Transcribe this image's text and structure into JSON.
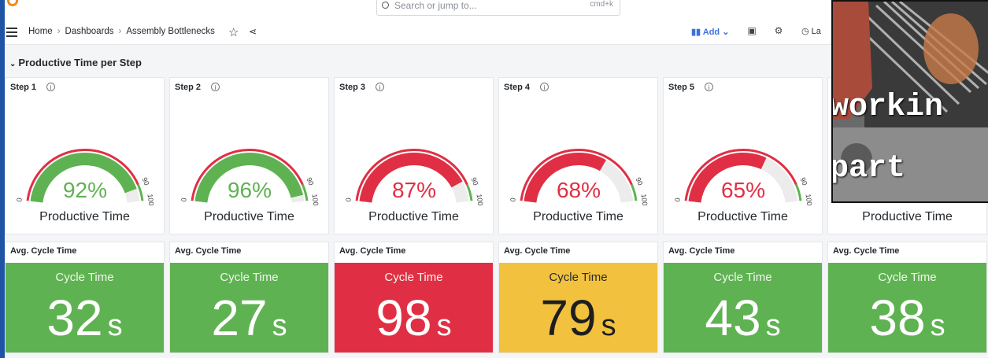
{
  "search": {
    "placeholder": "Search or jump to...",
    "shortcut": "cmd+k"
  },
  "breadcrumb": {
    "home": "Home",
    "dashboards": "Dashboards",
    "current": "Assembly Bottlenecks"
  },
  "toolbar": {
    "add_label": "Add",
    "time_label": "La"
  },
  "row": {
    "title": "Productive Time per Step"
  },
  "colors": {
    "green": "#5fb251",
    "red": "#e02f44",
    "yellow": "#f2c23f",
    "track": "#ececec"
  },
  "gauges": [
    {
      "title": "Step 1",
      "value": 92,
      "display": "92%",
      "label": "Productive Time",
      "color": "#5fb251"
    },
    {
      "title": "Step 2",
      "value": 96,
      "display": "96%",
      "label": "Productive Time",
      "color": "#5fb251"
    },
    {
      "title": "Step 3",
      "value": 87,
      "display": "87%",
      "label": "Productive Time",
      "color": "#e02f44"
    },
    {
      "title": "Step 4",
      "value": 68,
      "display": "68%",
      "label": "Productive Time",
      "color": "#e02f44"
    },
    {
      "title": "Step 5",
      "value": 65,
      "display": "65%",
      "label": "Productive Time",
      "color": "#e02f44"
    },
    {
      "title": "",
      "value": null,
      "display": "",
      "label": "Productive Time",
      "color": "#5fb251"
    }
  ],
  "gauge_ticks": {
    "min": "0",
    "threshold": "90",
    "max": "100"
  },
  "stats": [
    {
      "title": "Avg. Cycle Time",
      "label": "Cycle Time",
      "value": "32",
      "unit": "s",
      "color": "#5fb251"
    },
    {
      "title": "Avg. Cycle Time",
      "label": "Cycle Time",
      "value": "27",
      "unit": "s",
      "color": "#5fb251"
    },
    {
      "title": "Avg. Cycle Time",
      "label": "Cycle Time",
      "value": "98",
      "unit": "s",
      "color": "#e02f44"
    },
    {
      "title": "Avg. Cycle Time",
      "label": "Cycle Time",
      "value": "79",
      "unit": "s",
      "color": "#f2c23f"
    },
    {
      "title": "Avg. Cycle Time",
      "label": "Cycle Time",
      "value": "43",
      "unit": "s",
      "color": "#5fb251"
    },
    {
      "title": "Avg. Cycle Time",
      "label": "Cycle Time",
      "value": "38",
      "unit": "s",
      "color": "#5fb251"
    }
  ],
  "overlay": {
    "line1": "workin",
    "line2": "part"
  }
}
